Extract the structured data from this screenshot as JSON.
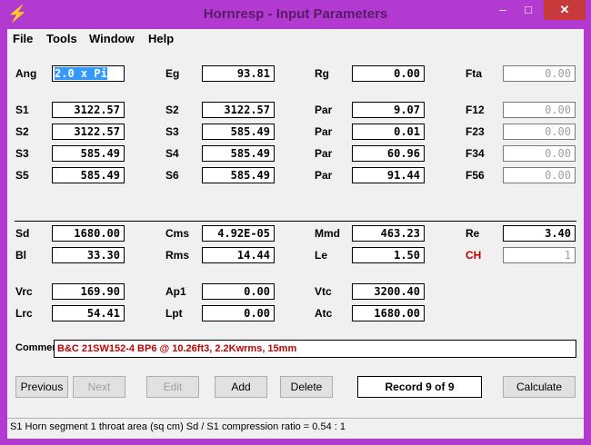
{
  "window": {
    "title": "Hornresp - Input Parameters",
    "icon": "lightning-icon",
    "controls": {
      "minimize": "‒",
      "maximize": "□",
      "close": "✕"
    }
  },
  "menu": [
    "File",
    "Tools",
    "Window",
    "Help"
  ],
  "rows": {
    "row1": [
      {
        "label": "Ang",
        "value": "2.0 x Pi",
        "selected": true
      },
      {
        "label": "Eg",
        "value": "93.81"
      },
      {
        "label": "Rg",
        "value": "0.00"
      },
      {
        "label": "Fta",
        "value": "0.00",
        "disabled": true
      }
    ],
    "row2": [
      {
        "label": "S1",
        "value": "3122.57"
      },
      {
        "label": "S2",
        "value": "3122.57"
      },
      {
        "label": "Par",
        "value": "9.07"
      },
      {
        "label": "F12",
        "value": "0.00",
        "disabled": true
      }
    ],
    "row3": [
      {
        "label": "S2",
        "value": "3122.57"
      },
      {
        "label": "S3",
        "value": "585.49"
      },
      {
        "label": "Par",
        "value": "0.01"
      },
      {
        "label": "F23",
        "value": "0.00",
        "disabled": true
      }
    ],
    "row4": [
      {
        "label": "S3",
        "value": "585.49"
      },
      {
        "label": "S4",
        "value": "585.49"
      },
      {
        "label": "Par",
        "value": "60.96"
      },
      {
        "label": "F34",
        "value": "0.00",
        "disabled": true
      }
    ],
    "row5": [
      {
        "label": "S5",
        "value": "585.49"
      },
      {
        "label": "S6",
        "value": "585.49"
      },
      {
        "label": "Par",
        "value": "91.44"
      },
      {
        "label": "F56",
        "value": "0.00",
        "disabled": true
      }
    ],
    "row6": [
      {
        "label": "Sd",
        "value": "1680.00"
      },
      {
        "label": "Cms",
        "value": "4.92E-05"
      },
      {
        "label": "Mmd",
        "value": "463.23"
      },
      {
        "label": "Re",
        "value": "3.40"
      }
    ],
    "row7": [
      {
        "label": "Bl",
        "value": "33.30"
      },
      {
        "label": "Rms",
        "value": "14.44"
      },
      {
        "label": "Le",
        "value": "1.50"
      },
      {
        "label": "CH",
        "value": "1",
        "disabled": true,
        "red": true
      }
    ],
    "row8": [
      {
        "label": "Vrc",
        "value": "169.90"
      },
      {
        "label": "Ap1",
        "value": "0.00"
      },
      {
        "label": "Vtc",
        "value": "3200.40"
      }
    ],
    "row9": [
      {
        "label": "Lrc",
        "value": "54.41"
      },
      {
        "label": "Lpt",
        "value": "0.00"
      },
      {
        "label": "Atc",
        "value": "1680.00"
      }
    ]
  },
  "comment": {
    "label": "Comment",
    "value": "B&C 21SW152-4 BP6 @ 10.26ft3, 2.2Kwrms, 15mm"
  },
  "buttons": {
    "previous": "Previous",
    "next": "Next",
    "edit": "Edit",
    "add": "Add",
    "delete": "Delete",
    "record": "Record 9 of 9",
    "calculate": "Calculate"
  },
  "status": "S1    Horn segment 1 throat area  (sq cm)    Sd / S1 compression ratio = 0.54 : 1"
}
